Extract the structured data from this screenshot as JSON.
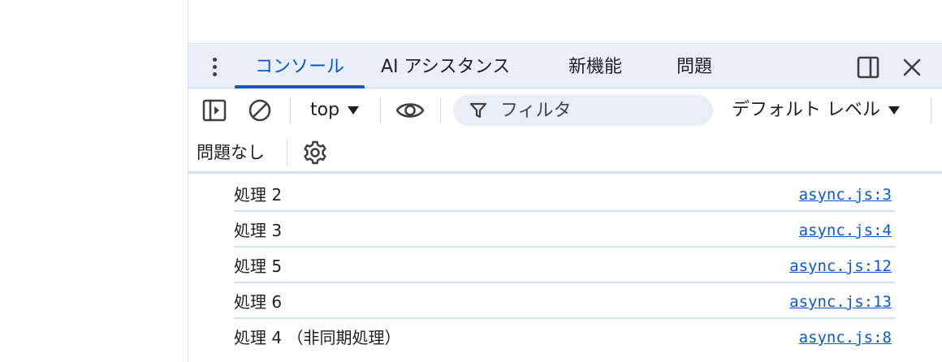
{
  "devtools": {
    "tabs": [
      {
        "label": "コンソール",
        "active": true
      },
      {
        "label": "AI アシスタンス",
        "active": false
      },
      {
        "label": "新機能",
        "active": false
      },
      {
        "label": "問題",
        "active": false
      }
    ],
    "icons": {
      "menu": "kebab-menu-icon",
      "dock": "dock-side-icon",
      "close": "close-icon"
    }
  },
  "toolbar": {
    "context": "top",
    "filter": {
      "placeholder": "フィルタ",
      "value": ""
    },
    "levels": "デフォルト レベル",
    "issues": "問題なし"
  },
  "console": {
    "messages": [
      {
        "text": "処理 2",
        "source": "async.js:3"
      },
      {
        "text": "処理 3",
        "source": "async.js:4"
      },
      {
        "text": "処理 5",
        "source": "async.js:12"
      },
      {
        "text": "処理 6",
        "source": "async.js:13"
      },
      {
        "text": "処理 4 （非同期処理）",
        "source": "async.js:8"
      }
    ]
  },
  "colors": {
    "accent": "#0b57d0",
    "tabbar": "#e9eff9",
    "border": "#d3e0f5"
  }
}
